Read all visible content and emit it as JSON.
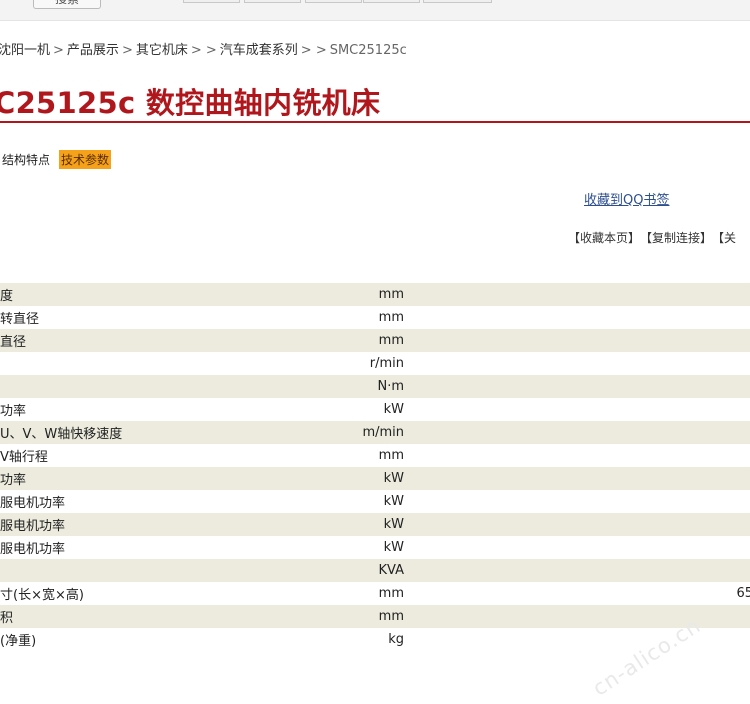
{
  "topbar": {
    "button_label": "搜索"
  },
  "breadcrumb": {
    "items": [
      "沈阳一机",
      "产品展示",
      "其它机床",
      "汽车成套系列"
    ],
    "separators": [
      ">",
      ">",
      "> >",
      "> >"
    ],
    "current": "SMC25125c"
  },
  "product": {
    "title": "C25125c 数控曲轴内铣机床"
  },
  "tabs": [
    {
      "label": "结构特点",
      "active": false
    },
    {
      "label": "技术参数",
      "active": true
    }
  ],
  "links": {
    "bookmark": "收藏到QQ书签",
    "actions": [
      "【收藏本页】",
      "【复制连接】",
      "【关"
    ]
  },
  "specs": [
    {
      "name": "度",
      "unit": "mm",
      "value": ""
    },
    {
      "name": "转直径",
      "unit": "mm",
      "value": ""
    },
    {
      "name": "直径",
      "unit": "mm",
      "value": ""
    },
    {
      "name": "",
      "unit": "r/min",
      "value": ""
    },
    {
      "name": "",
      "unit": "N·m",
      "value": ""
    },
    {
      "name": "功率",
      "unit": "kW",
      "value": ""
    },
    {
      "name": "U、V、W轴快移速度",
      "unit": "m/min",
      "value": ""
    },
    {
      "name": "V轴行程",
      "unit": "mm",
      "value": ""
    },
    {
      "name": "功率",
      "unit": "kW",
      "value": ""
    },
    {
      "name": "服电机功率",
      "unit": "kW",
      "value": ""
    },
    {
      "name": "服电机功率",
      "unit": "kW",
      "value": ""
    },
    {
      "name": "服电机功率",
      "unit": "kW",
      "value": ""
    },
    {
      "name": "",
      "unit": "KVA",
      "value": ""
    },
    {
      "name": "寸(长×宽×高)",
      "unit": "mm",
      "value": "65"
    },
    {
      "name": "积",
      "unit": "mm",
      "value": ""
    },
    {
      "name": "(净重)",
      "unit": "kg",
      "value": ""
    }
  ],
  "watermark": "cn-alico.cn",
  "colors": {
    "title": "#b0171c",
    "active_tab": "#f5a21a",
    "row_stripe": "#ecebde",
    "link": "#2d4f8f"
  }
}
